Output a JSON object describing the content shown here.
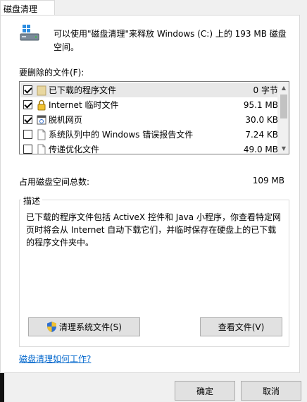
{
  "window": {
    "tab_label": "磁盘清理"
  },
  "header": {
    "line1": "可以使用\"磁盘清理\"来释放 Windows (C:) 上的 193 MB 磁盘",
    "line2": "空间。",
    "icon": "drive-icon"
  },
  "files_section": {
    "label": "要删除的文件(F):",
    "items": [
      {
        "label": "已下载的程序文件",
        "size": "0 字节",
        "checked": true,
        "icon": "folder-icon"
      },
      {
        "label": "Internet 临时文件",
        "size": "95.1 MB",
        "checked": true,
        "icon": "lock-icon"
      },
      {
        "label": "脱机网页",
        "size": "30.0 KB",
        "checked": true,
        "icon": "offline-page-icon"
      },
      {
        "label": "系统队列中的 Windows 错误报告文件",
        "size": "7.24 KB",
        "checked": false,
        "icon": "document-icon"
      },
      {
        "label": "传递优化文件",
        "size": "49.0 MB",
        "checked": false,
        "icon": "document-icon"
      }
    ]
  },
  "total": {
    "label": "占用磁盘空间总数:",
    "value": "109 MB"
  },
  "description": {
    "title": "描述",
    "line1": "已下载的程序文件包括 ActiveX 控件和 Java 小程序，你查看特定网",
    "line2": "页时将会从 Internet 自动下载它们，并临时保存在硬盘上的已下载",
    "line3": "的程序文件夹中。"
  },
  "buttons": {
    "clean_system": "清理系统文件(S)",
    "view_files": "查看文件(V)",
    "ok": "确定",
    "cancel": "取消"
  },
  "help_link": "磁盘清理如何工作?"
}
